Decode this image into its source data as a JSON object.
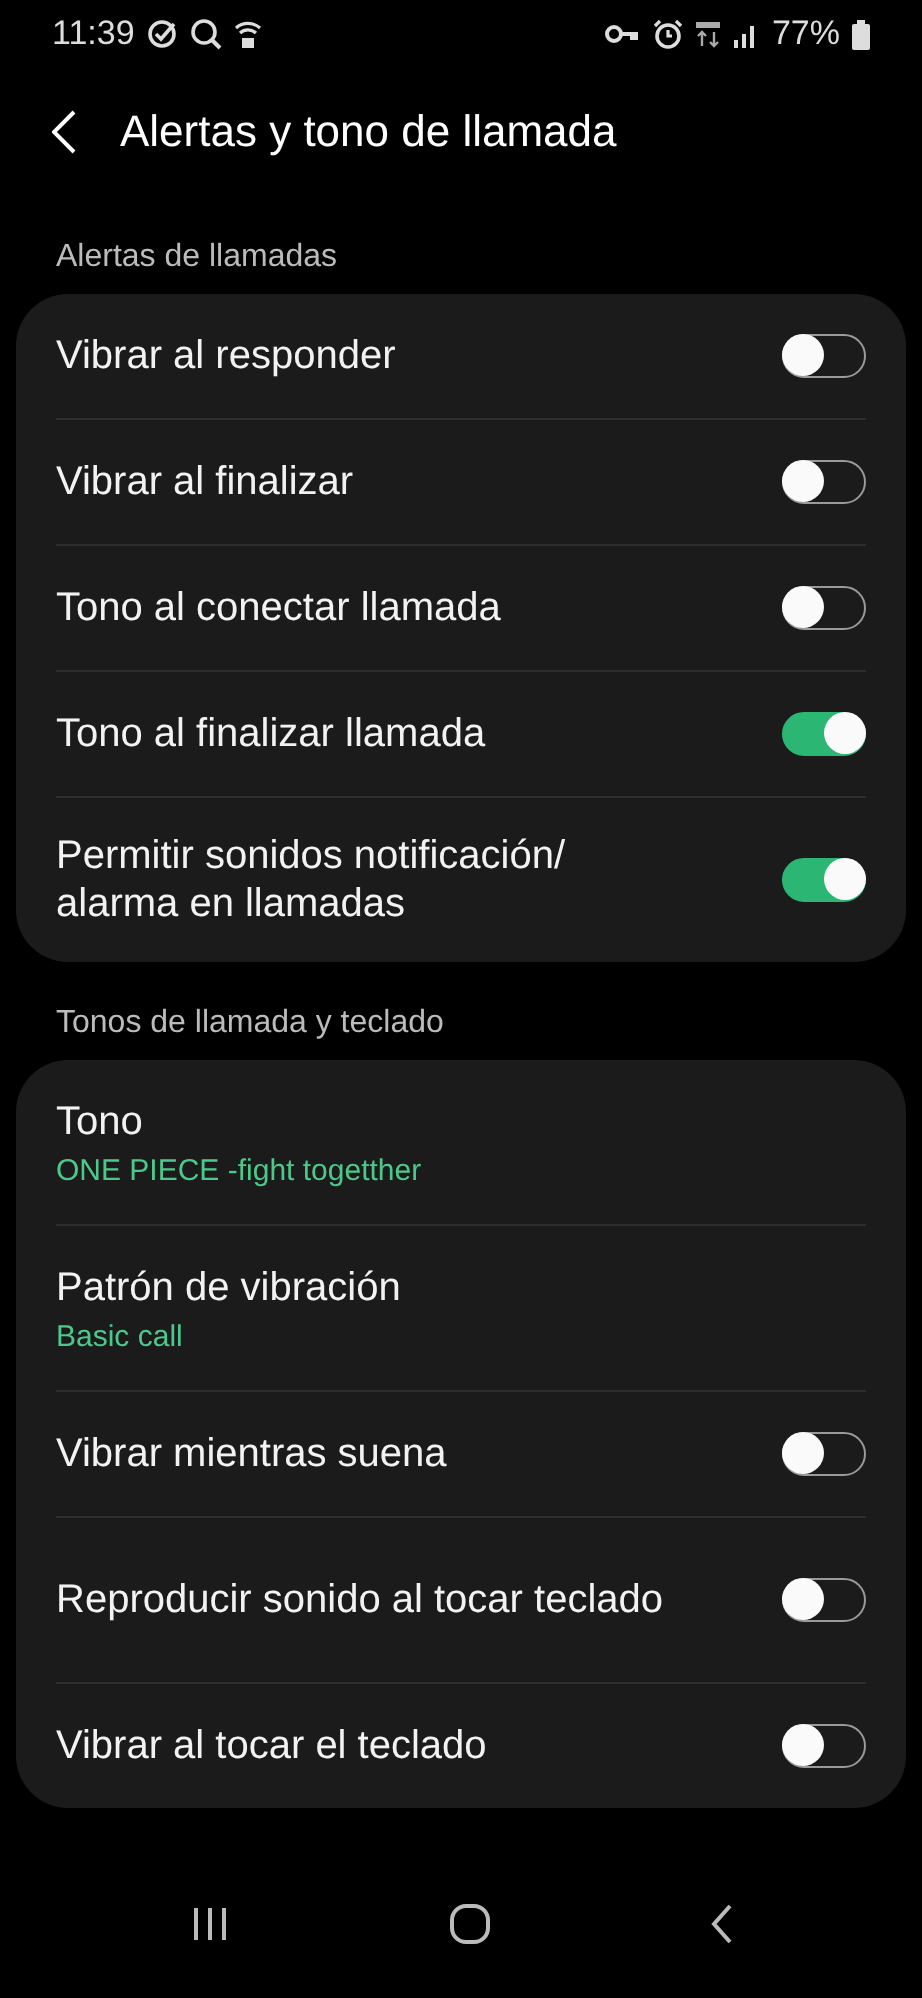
{
  "status_bar": {
    "time": "11:39",
    "battery": "77%"
  },
  "header": {
    "title": "Alertas y tono de llamada"
  },
  "sections": [
    {
      "title": "Alertas de llamadas",
      "items": [
        {
          "kind": "toggle",
          "label": "Vibrar al responder",
          "on": false
        },
        {
          "kind": "toggle",
          "label": "Vibrar al finalizar",
          "on": false
        },
        {
          "kind": "toggle",
          "label": "Tono al conectar llamada",
          "on": false
        },
        {
          "kind": "toggle",
          "label": "Tono al finalizar llamada",
          "on": true
        },
        {
          "kind": "toggle",
          "label": "Permitir sonidos notificación/ alarma en llamadas",
          "on": true
        }
      ]
    },
    {
      "title": "Tonos de llamada y teclado",
      "items": [
        {
          "kind": "link",
          "label": "Tono",
          "subtitle": "ONE PIECE -fight togetther"
        },
        {
          "kind": "link",
          "label": "Patrón de vibración",
          "subtitle": "Basic call"
        },
        {
          "kind": "toggle",
          "label": "Vibrar mientras suena",
          "on": false
        },
        {
          "kind": "toggle",
          "label": "Reproducir sonido al tocar teclado",
          "on": false
        },
        {
          "kind": "toggle",
          "label": "Vibrar al tocar el teclado",
          "on": false
        }
      ]
    }
  ]
}
